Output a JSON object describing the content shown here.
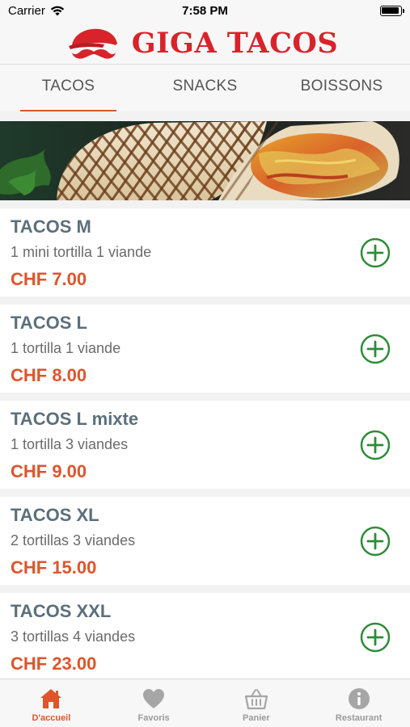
{
  "status_bar": {
    "carrier": "Carrier",
    "time": "7:58 PM"
  },
  "header": {
    "logo_text": "GIGA TACOS",
    "logo_color": "#d8232a"
  },
  "tabs": [
    {
      "label": "TACOS",
      "active": true
    },
    {
      "label": "SNACKS",
      "active": false
    },
    {
      "label": "BOISSONS",
      "active": false
    }
  ],
  "accent_color": "#e0542b",
  "add_icon_color": "#2e8b3a",
  "menu_items": [
    {
      "name": "TACOS M",
      "description": "1 mini tortilla 1 viande",
      "price": "CHF 7.00"
    },
    {
      "name": "TACOS L",
      "description": "1 tortilla 1 viande",
      "price": "CHF 8.00"
    },
    {
      "name": "TACOS L mixte",
      "description": "1 tortilla 3 viandes",
      "price": "CHF 9.00"
    },
    {
      "name": "TACOS XL",
      "description": "2 tortillas 3 viandes",
      "price": "CHF 15.00"
    },
    {
      "name": "TACOS XXL",
      "description": "3 tortillas 4 viandes",
      "price": "CHF 23.00"
    }
  ],
  "bottom_nav": [
    {
      "label": "D'accueil",
      "icon": "home-icon",
      "active": true
    },
    {
      "label": "Favoris",
      "icon": "heart-icon",
      "active": false
    },
    {
      "label": "Panier",
      "icon": "basket-icon",
      "active": false
    },
    {
      "label": "Restaurant",
      "icon": "info-icon",
      "active": false
    }
  ]
}
